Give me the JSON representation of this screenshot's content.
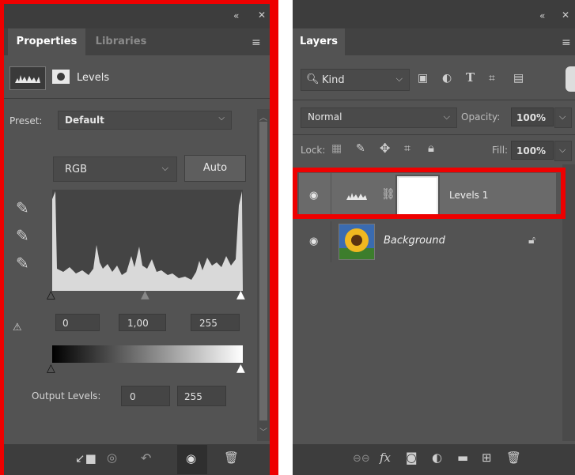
{
  "properties_panel": {
    "tabs": [
      "Properties",
      "Libraries"
    ],
    "adjustment_title": "Levels",
    "preset_label": "Preset:",
    "preset_value": "Default",
    "channel_value": "RGB",
    "auto_label": "Auto",
    "input_black": "0",
    "input_gamma": "1,00",
    "input_white": "255",
    "output_label": "Output Levels:",
    "output_black": "0",
    "output_white": "255",
    "icons": [
      "levels-histogram-icon",
      "layer-mask-icon",
      "black-eyedropper-icon",
      "gray-eyedropper-icon",
      "white-eyedropper-icon",
      "levels-warning-icon",
      "clip-to-layer-icon",
      "view-previous-icon",
      "reset-icon",
      "visibility-eye-icon",
      "trash-icon"
    ]
  },
  "layers_panel": {
    "tab": "Layers",
    "filter_label": "Kind",
    "blend_mode": "Normal",
    "opacity_label": "Opacity:",
    "opacity_value": "100%",
    "lock_label": "Lock:",
    "fill_label": "Fill:",
    "fill_value": "100%",
    "layers": [
      {
        "name": "Levels 1",
        "selected": true
      },
      {
        "name": "Background",
        "selected": false
      }
    ],
    "icons": [
      "search-icon",
      "image-filter-icon",
      "adjustment-filter-icon",
      "type-filter-icon",
      "shape-filter-icon",
      "smart-object-filter-icon",
      "lock-transparent-icon",
      "lock-image-icon",
      "lock-position-icon",
      "lock-artboard-icon",
      "lock-all-icon",
      "eye-icon",
      "chain-link-icon",
      "padlock-icon",
      "link-layers-icon",
      "fx-icon",
      "add-mask-icon",
      "new-adjustment-icon",
      "new-group-icon",
      "new-layer-icon",
      "delete-layer-icon"
    ]
  },
  "colors": {
    "highlight_red": "#ee0000",
    "panel_bg": "#535353"
  }
}
